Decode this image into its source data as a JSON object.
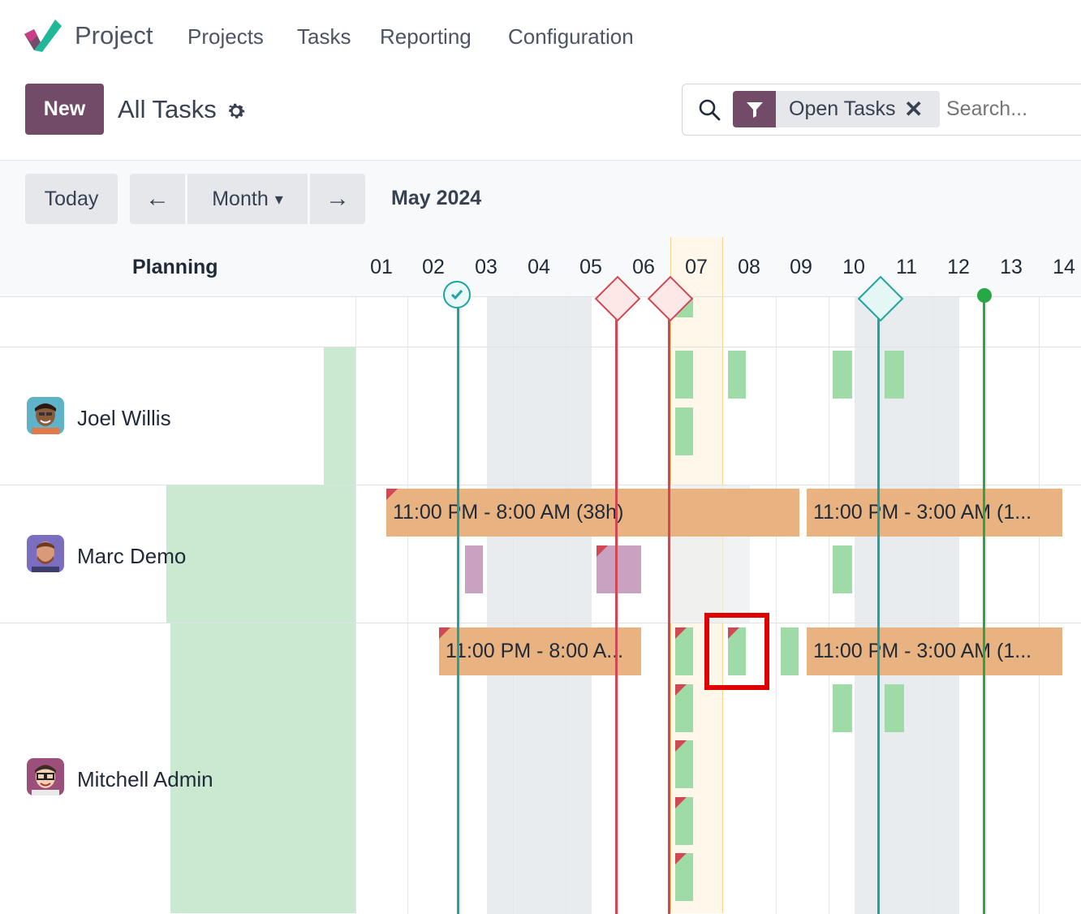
{
  "nav": {
    "app_name": "Project",
    "menu": [
      "Projects",
      "Tasks",
      "Reporting",
      "Configuration"
    ]
  },
  "control": {
    "new_label": "New",
    "view_title": "All Tasks",
    "facet_label": "Open Tasks",
    "facet_remove": "✕",
    "search_placeholder": "Search..."
  },
  "gantt": {
    "today_label": "Today",
    "prev": "←",
    "scale_label": "Month",
    "scale_caret": "▾",
    "next": "→",
    "period": "May 2024",
    "planning_header": "Planning",
    "days": [
      "01",
      "02",
      "03",
      "04",
      "05",
      "06",
      "07",
      "08",
      "09",
      "10",
      "11",
      "12",
      "13",
      "14"
    ],
    "today_day": "07",
    "users": [
      {
        "name": "Joel Willis"
      },
      {
        "name": "Marc Demo"
      },
      {
        "name": "Mitchell Admin"
      }
    ],
    "pills": [
      {
        "text": "11:00 PM - 8:00 AM (38h)"
      },
      {
        "text": "11:00 PM - 3:00 AM (1..."
      },
      {
        "text": "11:00 PM - 8:00 A..."
      },
      {
        "text": "11:00 PM - 3:00 AM (1..."
      }
    ]
  },
  "colors": {
    "brand": "#714b67",
    "pill": "#e8b381",
    "task_green": "#9edba6",
    "task_purple": "#c8a2c0",
    "deadline_red": "#d14855",
    "milestone_teal": "#1fa2a0",
    "milestone_green": "#28a745",
    "highlight": "#e00000"
  }
}
